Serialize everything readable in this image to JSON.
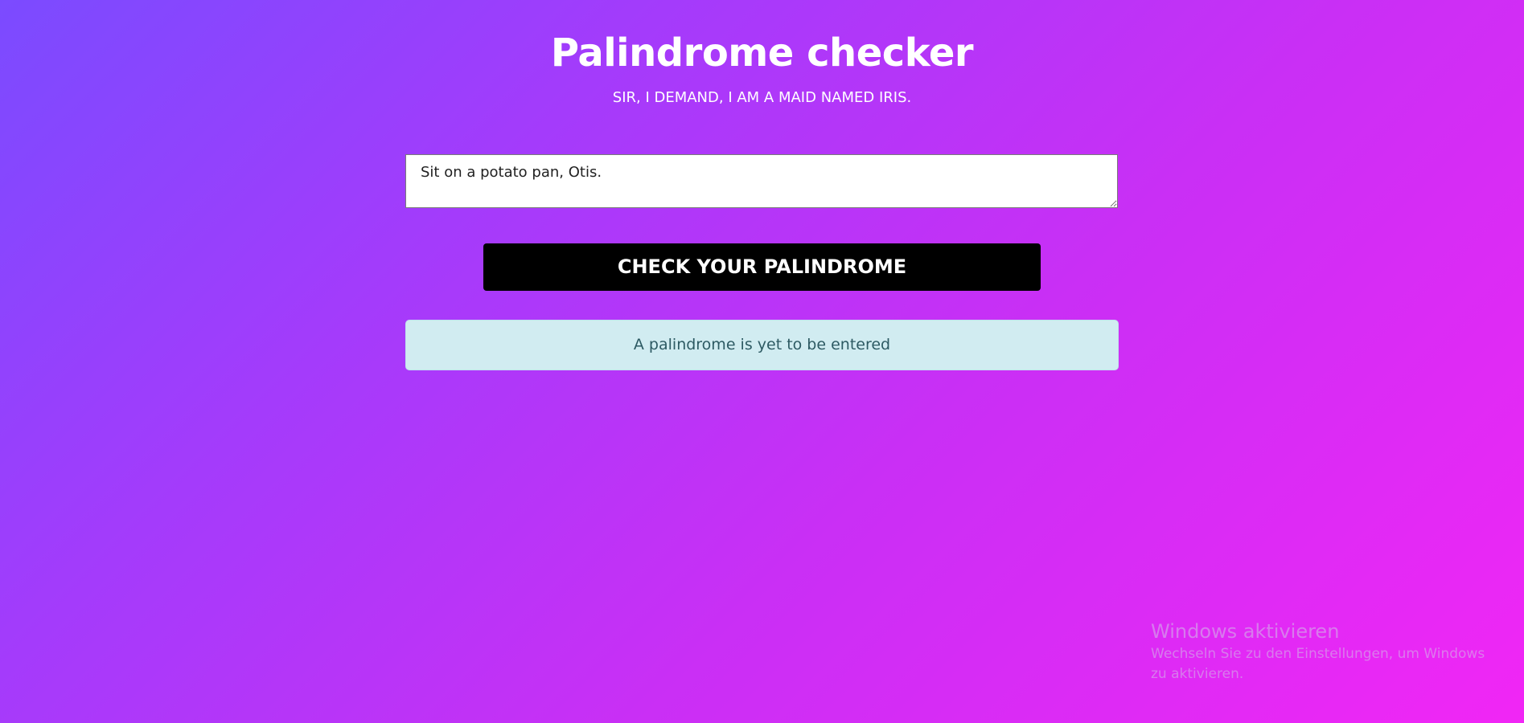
{
  "header": {
    "title": "Palindrome checker",
    "subtitle": "SIR, I DEMAND, I AM A MAID NAMED IRIS."
  },
  "form": {
    "input_value": "Sit on a potato pan, Otis.",
    "button_label": "CHECK YOUR PALINDROME"
  },
  "result": {
    "message": "A palindrome is yet to be entered"
  },
  "os_watermark": {
    "title": "Windows aktivieren",
    "text": "Wechseln Sie zu den Einstellungen, um Windows zu aktivieren."
  },
  "colors": {
    "gradient_start": "#7b4bff",
    "gradient_end": "#f126f5",
    "button_bg": "#000000",
    "alert_bg": "#d1ecf1",
    "alert_text": "#2d5a63"
  }
}
